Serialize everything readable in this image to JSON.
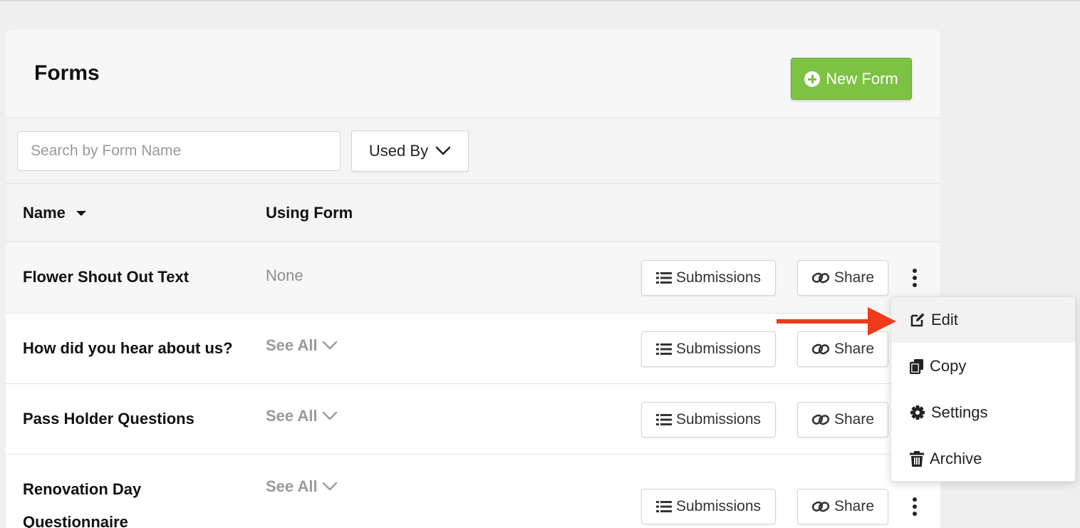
{
  "header": {
    "title": "Forms",
    "new_form_label": "New Form"
  },
  "filters": {
    "search_placeholder": "Search by Form Name",
    "used_by_label": "Used By"
  },
  "table": {
    "columns": [
      "Name",
      "Using Form"
    ],
    "rows": [
      {
        "name": "Flower Shout Out Text",
        "using": "None"
      },
      {
        "name": "How did you hear about us?",
        "using": "See All"
      },
      {
        "name": "Pass Holder Questions",
        "using": "See All"
      },
      {
        "name": "Renovation Day Questionnaire",
        "using": "See All"
      }
    ],
    "submissions_label": "Submissions",
    "share_label": "Share"
  },
  "menu": {
    "items": [
      "Edit",
      "Copy",
      "Settings",
      "Archive"
    ]
  },
  "colors": {
    "accent_green": "#7dc242",
    "arrow_red": "#f03a1a"
  }
}
